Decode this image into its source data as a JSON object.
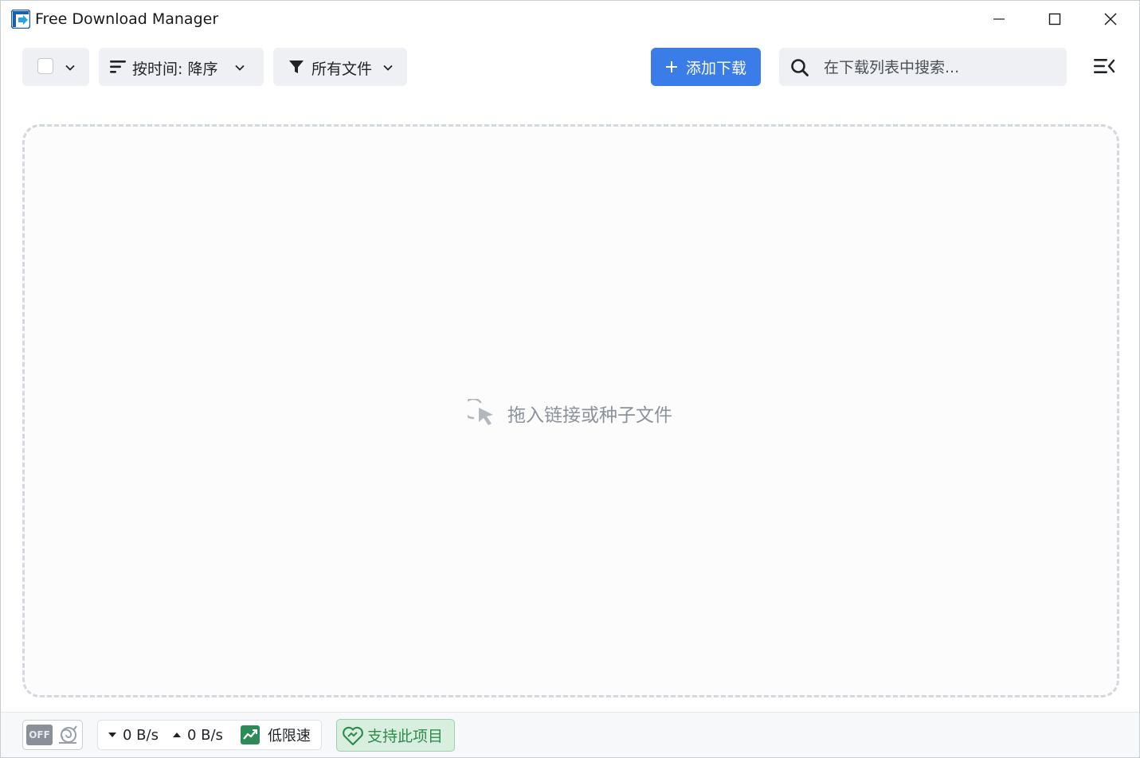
{
  "window": {
    "title": "Free Download Manager",
    "icon": "fdm-logo-icon",
    "controls": [
      "minimize-icon",
      "maximize-icon",
      "close-icon"
    ]
  },
  "toolbar": {
    "select_all": {
      "checked": false,
      "icon": "chevron-down-icon"
    },
    "sort": {
      "label": "按时间: 降序",
      "icon": "sort-lines-icon"
    },
    "filter": {
      "label": "所有文件",
      "icon": "filter-funnel-icon"
    },
    "add_download": {
      "label": "添加下载",
      "icon": "plus-icon"
    },
    "search": {
      "placeholder": "在下载列表中搜索...",
      "value": "",
      "icon": "search-icon"
    },
    "menu_icon": "menu-collapse-icon"
  },
  "dropzone": {
    "hint": "拖入链接或种子文件",
    "icon": "drag-pointer-icon"
  },
  "statusbar": {
    "snail_mode": {
      "label": "OFF",
      "icon": "snail-icon"
    },
    "download_speed": "0 B/s",
    "upload_speed": "0 B/s",
    "speed_limit_label": "低限速",
    "support_label": "支持此项目"
  },
  "colors": {
    "accent": "#3a7de9",
    "toolbar_bg": "#eef0f4",
    "support_green": "#2f8a4e",
    "dropzone_border": "#d3d8de"
  }
}
